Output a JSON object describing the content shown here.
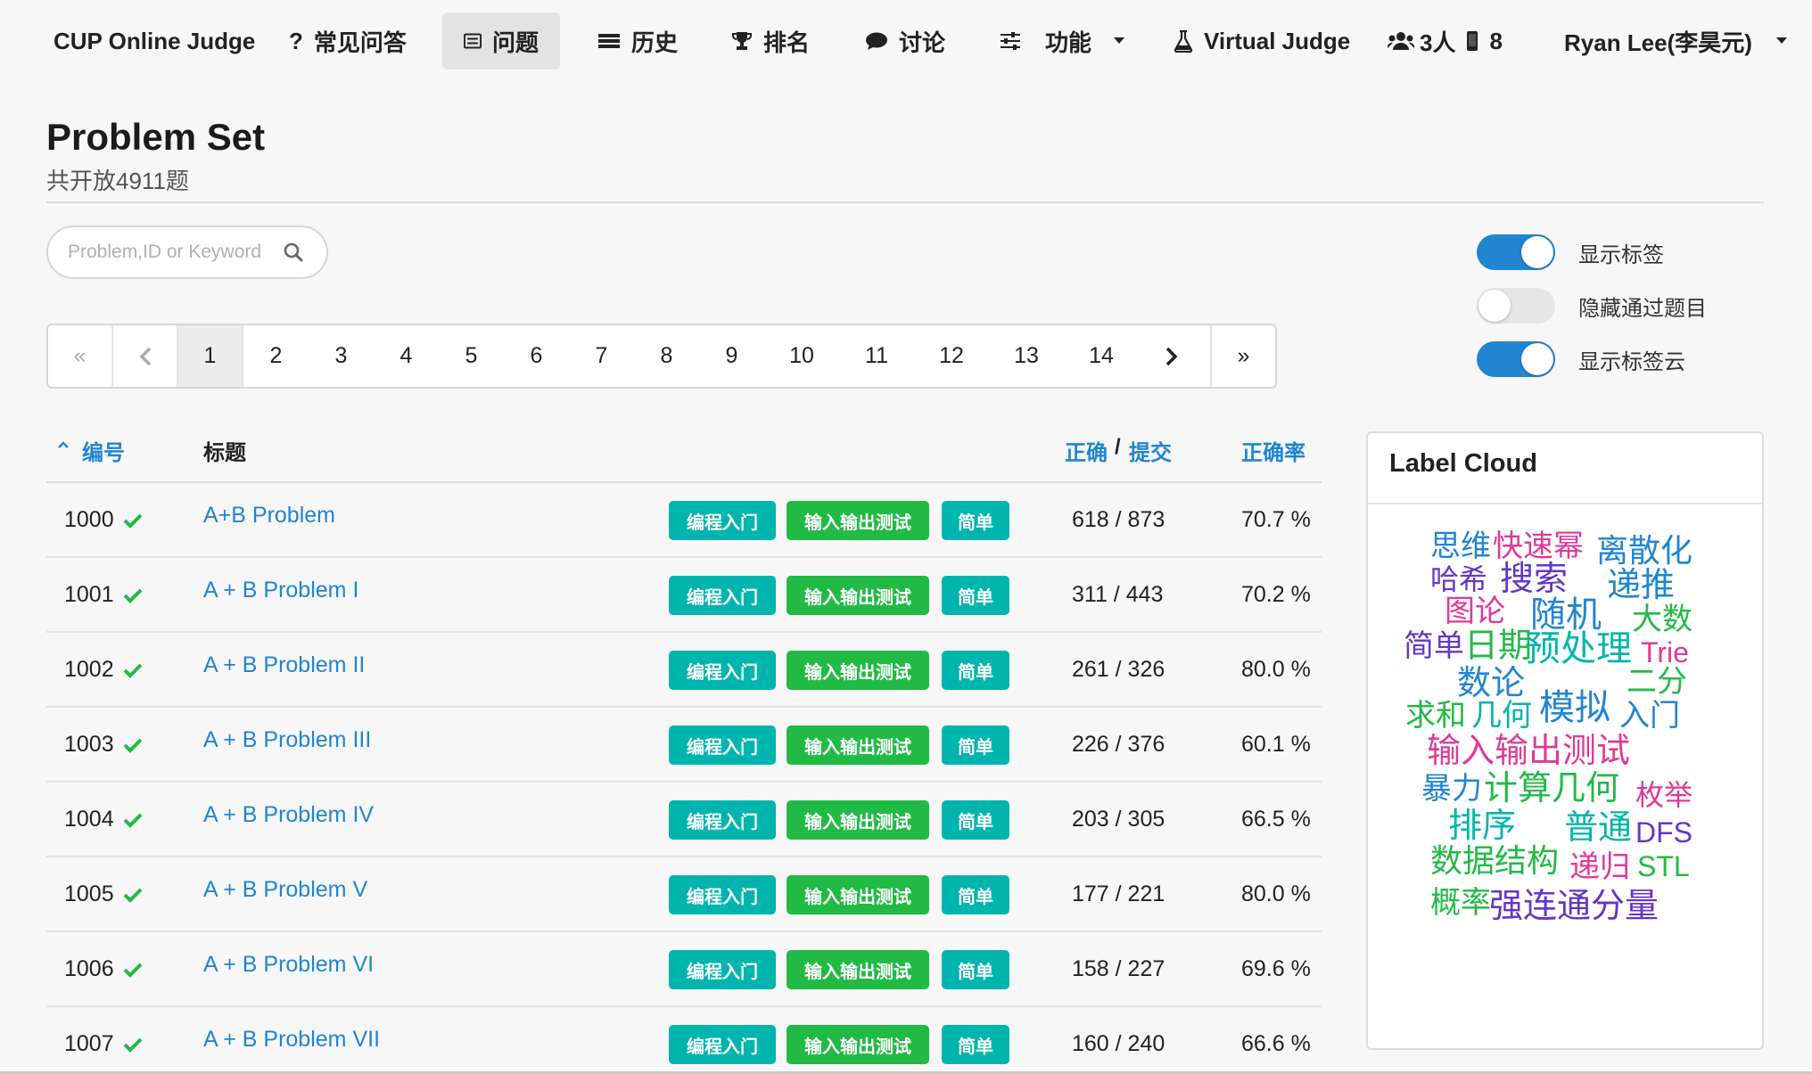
{
  "nav": {
    "brand": "CUP Online Judge",
    "faq": "常见问答",
    "problems": "问题",
    "history": "历史",
    "ranking": "排名",
    "discuss": "讨论",
    "features": "功能",
    "virtual_judge": "Virtual Judge",
    "online_users": "3人",
    "online_devices": "8",
    "user": "Ryan Lee(李昊元)"
  },
  "header": {
    "title": "Problem Set",
    "subtitle": "共开放4911题"
  },
  "search": {
    "placeholder": "Problem,ID or Keyword",
    "value": ""
  },
  "toggles": [
    {
      "label": "显示标签",
      "on": true
    },
    {
      "label": "隐藏通过题目",
      "on": false
    },
    {
      "label": "显示标签云",
      "on": true
    }
  ],
  "pagination": {
    "first": "«",
    "last": "»",
    "current": 1,
    "pages": [
      "1",
      "2",
      "3",
      "4",
      "5",
      "6",
      "7",
      "8",
      "9",
      "10",
      "11",
      "12",
      "13",
      "14"
    ]
  },
  "table": {
    "col_id": "编号",
    "col_title": "标题",
    "col_correct": "正确",
    "col_sep": "/",
    "col_submit": "提交",
    "col_rate": "正确率",
    "tags": [
      "编程入门",
      "输入输出测试",
      "简单"
    ],
    "rows": [
      {
        "id": "1000",
        "title": "A+B Problem",
        "ratio": "618 / 873",
        "rate": "70.7 %"
      },
      {
        "id": "1001",
        "title": "A + B Problem I",
        "ratio": "311 / 443",
        "rate": "70.2 %"
      },
      {
        "id": "1002",
        "title": "A + B Problem II",
        "ratio": "261 / 326",
        "rate": "80.0 %"
      },
      {
        "id": "1003",
        "title": "A + B Problem III",
        "ratio": "226 / 376",
        "rate": "60.1 %"
      },
      {
        "id": "1004",
        "title": "A + B Problem IV",
        "ratio": "203 / 305",
        "rate": "66.5 %"
      },
      {
        "id": "1005",
        "title": "A + B Problem V",
        "ratio": "177 / 221",
        "rate": "80.0 %"
      },
      {
        "id": "1006",
        "title": "A + B Problem VI",
        "ratio": "158 / 227",
        "rate": "69.6 %"
      },
      {
        "id": "1007",
        "title": "A + B Problem VII",
        "ratio": "160 / 240",
        "rate": "66.6 %"
      }
    ]
  },
  "label_cloud": {
    "title": "Label Cloud",
    "words": [
      {
        "text": "思维",
        "color": "#2185d0"
      },
      {
        "text": "快速幂",
        "color": "#e03997"
      },
      {
        "text": "离散化",
        "color": "#2185d0"
      },
      {
        "text": "哈希",
        "color": "#6435c9"
      },
      {
        "text": "搜索",
        "color": "#6435c9"
      },
      {
        "text": "递推",
        "color": "#2185d0"
      },
      {
        "text": "图论",
        "color": "#e03997"
      },
      {
        "text": "随机",
        "color": "#2185d0"
      },
      {
        "text": "大数",
        "color": "#21ba45"
      },
      {
        "text": "简单",
        "color": "#6435c9"
      },
      {
        "text": "日期",
        "color": "#21ba45"
      },
      {
        "text": "预处理",
        "color": "#00b5ad"
      },
      {
        "text": "Trie",
        "color": "#e03997"
      },
      {
        "text": "数论",
        "color": "#2185d0"
      },
      {
        "text": "二分",
        "color": "#21ba45"
      },
      {
        "text": "求和",
        "color": "#21ba45"
      },
      {
        "text": "几何",
        "color": "#00b5ad"
      },
      {
        "text": "模拟",
        "color": "#2185d0"
      },
      {
        "text": "入门",
        "color": "#2185d0"
      },
      {
        "text": "输入输出测试",
        "color": "#e03997"
      },
      {
        "text": "暴力",
        "color": "#2185d0"
      },
      {
        "text": "计算几何",
        "color": "#21ba45"
      },
      {
        "text": "枚举",
        "color": "#e03997"
      },
      {
        "text": "排序",
        "color": "#00b5ad"
      },
      {
        "text": "普通",
        "color": "#00b5ad"
      },
      {
        "text": "DFS",
        "color": "#6435c9"
      },
      {
        "text": "数据结构",
        "color": "#21ba45"
      },
      {
        "text": "递归",
        "color": "#e03997"
      },
      {
        "text": "STL",
        "color": "#21ba45"
      },
      {
        "text": "概率",
        "color": "#21ba45"
      },
      {
        "text": "强连通分量",
        "color": "#6435c9"
      }
    ]
  },
  "colors": {
    "link": "#2185d0",
    "teal": "#00b5ad",
    "green": "#21ba45",
    "check": "#21ba45"
  }
}
